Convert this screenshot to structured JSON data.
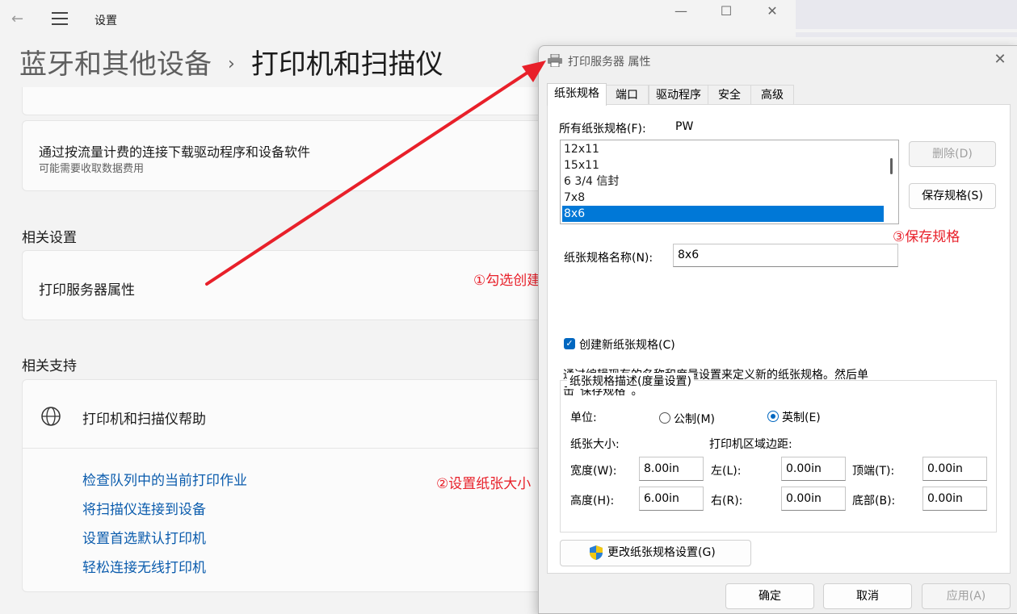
{
  "settings": {
    "window_title": "设置",
    "breadcrumb": {
      "parent": "蓝牙和其他设备",
      "separator": "›",
      "current": "打印机和扫描仪"
    },
    "metered": {
      "title": "通过按流量计费的连接下载驱动程序和设备软件",
      "subtitle": "可能需要收取数据费用"
    },
    "related_settings": {
      "header": "相关设置",
      "item": "打印服务器属性"
    },
    "related_support": {
      "header": "相关支持",
      "help_title": "打印机和扫描仪帮助",
      "links": [
        "检查队列中的当前打印作业",
        "将扫描仪连接到设备",
        "设置首选默认打印机",
        "轻松连接无线打印机"
      ]
    }
  },
  "annotations": {
    "step1": "①勾选创建",
    "step2": "②设置纸张大小",
    "step3": "③保存规格"
  },
  "dialog": {
    "title": "打印服务器 属性",
    "tabs": [
      "纸张规格",
      "端口",
      "驱动程序",
      "安全",
      "高级"
    ],
    "all_forms_label": "所有纸张规格(F):",
    "server_name": "PW",
    "forms": [
      "12x11",
      "15x11",
      "6 3/4 信封",
      "7x8",
      "8x6"
    ],
    "selected_form": "8x6",
    "delete_btn": "删除(D)",
    "save_btn": "保存规格(S)",
    "form_name_label": "纸张规格名称(N):",
    "form_name_value": "8x6",
    "create_new_label": "创建新纸张规格(C)",
    "description_line1": "通过编辑现有的名称和度量设置来定义新的纸张规格。然后单",
    "description_line2": "击“保存规格”。",
    "group_title": "纸张规格描述(度量设置)",
    "units_label": "单位:",
    "metric_label": "公制(M)",
    "english_label": "英制(E)",
    "paper_size_label": "纸张大小:",
    "margins_label": "打印机区域边距:",
    "width_label": "宽度(W):",
    "width_value": "8.00in",
    "height_label": "高度(H):",
    "height_value": "6.00in",
    "left_label": "左(L):",
    "left_value": "0.00in",
    "right_label": "右(R):",
    "right_value": "0.00in",
    "top_label": "顶端(T):",
    "top_value": "0.00in",
    "bottom_label": "底部(B):",
    "bottom_value": "0.00in",
    "change_btn": "更改纸张规格设置(G)",
    "ok_btn": "确定",
    "cancel_btn": "取消",
    "apply_btn": "应用(A)"
  },
  "colors": {
    "accent": "#0067c0",
    "annotation": "#e8202a",
    "link": "#0b5cad"
  }
}
